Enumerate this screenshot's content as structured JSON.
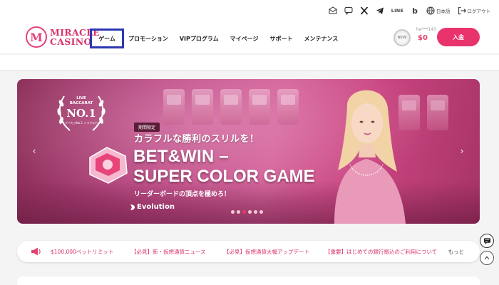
{
  "topbar": {
    "icons": [
      "mail-icon",
      "chat-icon",
      "x-icon",
      "telegram-icon",
      "line-icon",
      "b-icon"
    ],
    "line_label": "LINE",
    "b_label": "b",
    "language": "日本語",
    "logout": "ログアウト"
  },
  "header": {
    "logo_mark": "M",
    "logo_line1": "MIRACLE",
    "logo_line2": "CASINO",
    "nav": [
      {
        "label": "ゲーム"
      },
      {
        "label": "プロモーション"
      },
      {
        "label": "VIPプログラム"
      },
      {
        "label": "マイページ"
      },
      {
        "label": "サポート"
      },
      {
        "label": "メンテナンス"
      }
    ],
    "new_badge": "NEW",
    "username": "ha***143",
    "balance": "$0",
    "deposit_label": "入金"
  },
  "hero": {
    "award_line1": "LIVE",
    "award_line2": "BACCARAT",
    "award_rank": "NO.1",
    "award_sub": "ライブバカラNo.1 ミラクルカジノ",
    "tag": "期間限定",
    "headline": "カラフルな勝利のスリルを！",
    "title_line1": "BET&WIN –",
    "title_line2": "SUPER COLOR GAME",
    "subhead": "リーダーボードの頂点を極めろ！",
    "brand": "Evolution",
    "prev_icon": "‹",
    "next_icon": "›",
    "dots_total": 6,
    "dots_active_index": 2
  },
  "ticker": {
    "items": [
      "$100,000ベットリミット",
      "【必見】新・仮想通貨ニュース",
      "【必見】仮想通貨大幅アップデート",
      "【重要】はじめての銀行振込のご利用について"
    ],
    "more_label": "もっと"
  },
  "colors": {
    "brand_pink": "#e8336c",
    "active_nav_border": "#2c37b5"
  }
}
